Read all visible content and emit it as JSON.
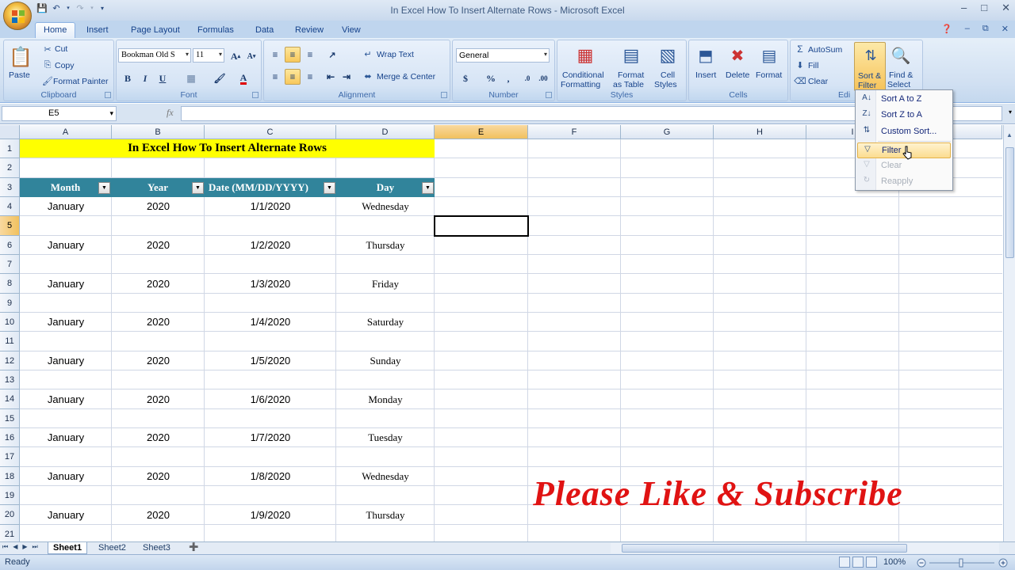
{
  "window": {
    "title": "In Excel How To Insert Alternate Rows - Microsoft Excel"
  },
  "tabs": [
    "Home",
    "Insert",
    "Page Layout",
    "Formulas",
    "Data",
    "Review",
    "View"
  ],
  "ribbon": {
    "clipboard": {
      "label": "Clipboard",
      "paste": "Paste",
      "cut": "Cut",
      "copy": "Copy",
      "format_painter": "Format Painter"
    },
    "font": {
      "label": "Font",
      "font_name": "Bookman Old S",
      "font_size": "11"
    },
    "alignment": {
      "label": "Alignment",
      "wrap_text": "Wrap Text",
      "merge_center": "Merge & Center"
    },
    "number": {
      "label": "Number",
      "format": "General"
    },
    "styles": {
      "label": "Styles",
      "conditional_formatting_1": "Conditional",
      "conditional_formatting_2": "Formatting",
      "format_table_1": "Format",
      "format_table_2": "as Table",
      "cell_styles_1": "Cell",
      "cell_styles_2": "Styles"
    },
    "cells": {
      "label": "Cells",
      "insert": "Insert",
      "delete": "Delete",
      "format": "Format"
    },
    "editing": {
      "label": "Edi",
      "autosum": "AutoSum",
      "fill": "Fill",
      "clear": "Clear",
      "sort_filter_1": "Sort &",
      "sort_filter_2": "Filter",
      "find_select_1": "Find &",
      "find_select_2": "Select"
    }
  },
  "formula_bar": {
    "name_box": "E5",
    "fx": "fx",
    "value": ""
  },
  "columns": [
    "A",
    "B",
    "C",
    "D",
    "E",
    "F",
    "G",
    "H",
    "I"
  ],
  "sheet": {
    "title": "In Excel How To Insert Alternate Rows",
    "headers": [
      "Month",
      "Year",
      "Date (MM/DD/YYYY)",
      "Day"
    ],
    "rows": [
      [
        "January",
        "2020",
        "1/1/2020",
        "Wednesday"
      ],
      [
        "January",
        "2020",
        "1/2/2020",
        "Thursday"
      ],
      [
        "January",
        "2020",
        "1/3/2020",
        "Friday"
      ],
      [
        "January",
        "2020",
        "1/4/2020",
        "Saturday"
      ],
      [
        "January",
        "2020",
        "1/5/2020",
        "Sunday"
      ],
      [
        "January",
        "2020",
        "1/6/2020",
        "Monday"
      ],
      [
        "January",
        "2020",
        "1/7/2020",
        "Tuesday"
      ],
      [
        "January",
        "2020",
        "1/8/2020",
        "Wednesday"
      ],
      [
        "January",
        "2020",
        "1/9/2020",
        "Thursday"
      ]
    ],
    "row_numbers": [
      "1",
      "2",
      "3",
      "4",
      "5",
      "6",
      "7",
      "8",
      "9",
      "10",
      "11",
      "12",
      "13",
      "14",
      "15",
      "16",
      "17",
      "18",
      "19",
      "20",
      "21"
    ]
  },
  "watermark": "Please Like & Subscribe",
  "sort_menu": {
    "items": [
      {
        "label": "Sort A to Z",
        "icon": "sort-a-z-icon",
        "enabled": true
      },
      {
        "label": "Sort Z to A",
        "icon": "sort-z-a-icon",
        "enabled": true
      },
      {
        "label": "Custom Sort...",
        "icon": "custom-sort-icon",
        "enabled": true
      },
      {
        "label": "Filter",
        "icon": "filter-icon",
        "enabled": true
      },
      {
        "label": "Clear",
        "icon": "clear-filter-icon",
        "enabled": false
      },
      {
        "label": "Reapply",
        "icon": "reapply-icon",
        "enabled": false
      }
    ]
  },
  "sheet_tabs": [
    "Sheet1",
    "Sheet2",
    "Sheet3"
  ],
  "status": {
    "text": "Ready",
    "zoom": "100%"
  },
  "colors": {
    "title_fill": "#ffff00",
    "header_fill": "#31849b",
    "watermark": "#e01313"
  }
}
